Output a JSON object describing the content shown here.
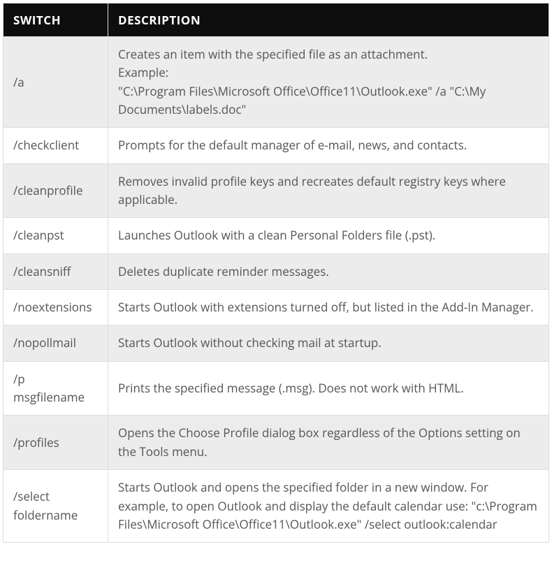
{
  "table": {
    "headers": {
      "switch": "Switch",
      "description": "Description"
    },
    "rows": [
      {
        "switch": "/a",
        "description": "Creates an item with the specified file as an attachment.\nExample:\n\"C:\\Program Files\\Microsoft Office\\Office11\\Outlook.exe\" /a \"C:\\My Documents\\labels.doc\""
      },
      {
        "switch": "/checkclient",
        "description": "Prompts for the default manager of e-mail, news, and contacts."
      },
      {
        "switch": "/cleanprofile",
        "description": "Removes invalid profile keys and recreates default registry keys where applicable."
      },
      {
        "switch": "/cleanpst",
        "description": "Launches Outlook with a clean Personal Folders file (.pst)."
      },
      {
        "switch": "/cleansniff",
        "description": "Deletes duplicate reminder messages."
      },
      {
        "switch": "/noextensions",
        "description": "Starts Outlook with extensions turned off, but listed in the Add-In Manager."
      },
      {
        "switch": "/nopollmail",
        "description": "Starts Outlook without checking mail at startup."
      },
      {
        "switch": "/p msgfilename",
        "description": "Prints the specified message (.msg). Does not work with HTML."
      },
      {
        "switch": "/profiles",
        "description": "Opens the Choose Profile dialog box regardless of the Options setting on the Tools menu."
      },
      {
        "switch": "/select foldername",
        "description": "Starts Outlook and opens the specified folder in a new window. For example, to open Outlook and display the default calendar use: \"c:\\Program Files\\Microsoft Office\\Office11\\Outlook.exe\" /select outlook:calendar"
      }
    ]
  }
}
